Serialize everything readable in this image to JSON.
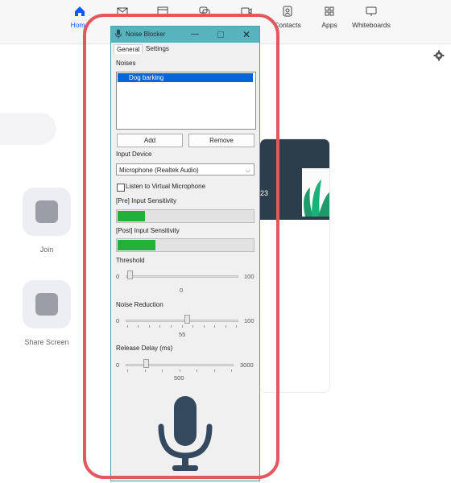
{
  "app": {
    "nav": [
      {
        "label": "Home",
        "icon": "home-icon"
      },
      {
        "label": "",
        "icon": "mail-icon"
      },
      {
        "label": "",
        "icon": "calendar-icon"
      },
      {
        "label": "",
        "icon": "chat-icon"
      },
      {
        "label": "",
        "icon": "video-icon"
      },
      {
        "label": "Contacts",
        "icon": "contacts-icon"
      },
      {
        "label": "Apps",
        "icon": "apps-icon"
      },
      {
        "label": "Whiteboards",
        "icon": "whiteboard-icon"
      }
    ],
    "join_label": "Join",
    "share_label": "Share Screen",
    "card_partial_text": "23",
    "accent_color": "#0b5cff"
  },
  "window": {
    "title": "Noise Blocker",
    "titlebar_color": "#57b3bd",
    "tabs": [
      "General",
      "Settings"
    ],
    "active_tab": "General",
    "noises_label": "Noises",
    "noises": [
      "Dog barking"
    ],
    "add_label": "Add",
    "remove_label": "Remove",
    "input_device_label": "Input Device",
    "input_device_value": "Microphone (Realtek Audio)",
    "virtual_mic_label": "Listen to Virtual Microphone",
    "virtual_mic_checked": false,
    "pre_label": "[Pre] Input Sensitivity",
    "pre_level": 0.2,
    "post_label": "[Post] Input Sensitivity",
    "post_level": 0.28,
    "meter_color": "#20b13c",
    "threshold": {
      "label": "Threshold",
      "min": "0",
      "max": "100",
      "value": "0"
    },
    "noise_reduction": {
      "label": "Noise Reduction",
      "min": "0",
      "max": "100",
      "value": "55"
    },
    "release_delay": {
      "label": "Release Delay (ms)",
      "min": "0",
      "max": "3000",
      "value": "500"
    }
  },
  "highlight_color": "#e2585f"
}
